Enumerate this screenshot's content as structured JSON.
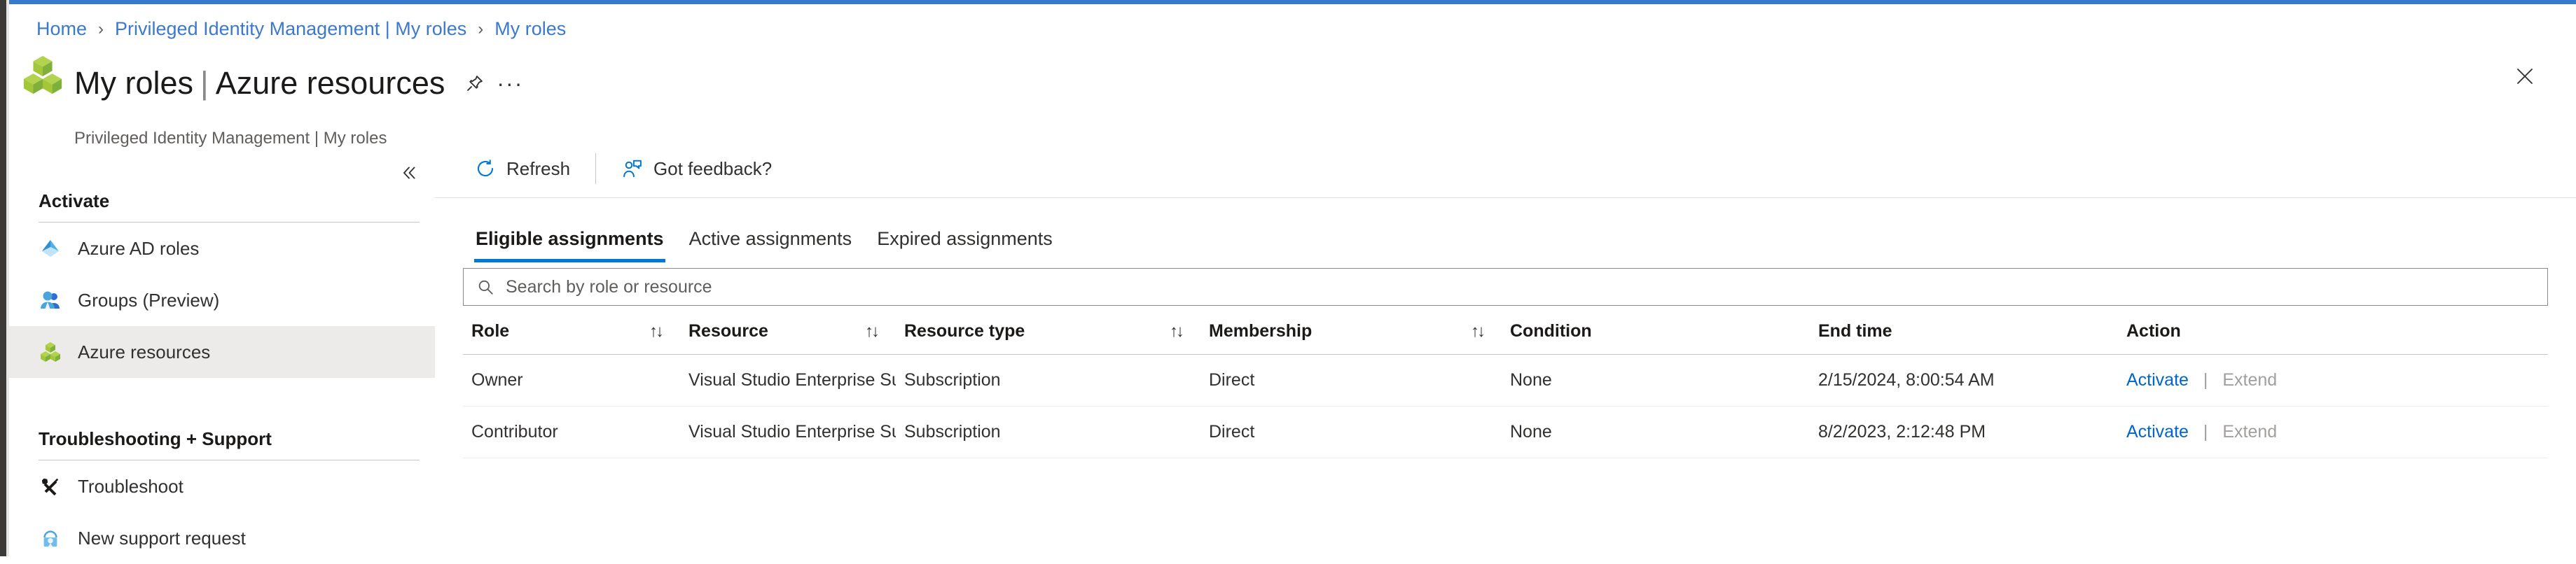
{
  "accent_color": "#3b79cc",
  "link_color": "#0066cc",
  "breadcrumb": {
    "items": [
      {
        "label": "Home"
      },
      {
        "label": "Privileged Identity Management | My roles"
      },
      {
        "label": "My roles"
      }
    ],
    "separator": "›"
  },
  "header": {
    "title_main": "My roles",
    "title_sep": "|",
    "title_secondary": "Azure resources",
    "subtitle": "Privileged Identity Management | My roles",
    "pin_icon": "pin-icon",
    "more_icon": "ellipsis-icon",
    "close_icon": "close-icon",
    "logo_icon": "pim-cubes-icon"
  },
  "sidebar": {
    "collapse_icon": "double-chevron-left-icon",
    "groups": [
      {
        "title": "Activate",
        "items": [
          {
            "label": "Azure AD roles",
            "icon": "azure-ad-icon",
            "selected": false
          },
          {
            "label": "Groups (Preview)",
            "icon": "groups-people-icon",
            "selected": false
          },
          {
            "label": "Azure resources",
            "icon": "azure-resources-cubes-icon",
            "selected": true
          }
        ]
      },
      {
        "title": "Troubleshooting + Support",
        "items": [
          {
            "label": "Troubleshoot",
            "icon": "wrench-screwdriver-icon",
            "selected": false
          },
          {
            "label": "New support request",
            "icon": "headset-support-icon",
            "selected": false
          }
        ]
      }
    ]
  },
  "toolbar": {
    "refresh_label": "Refresh",
    "refresh_icon": "refresh-circular-arrow-icon",
    "feedback_label": "Got feedback?",
    "feedback_icon": "person-speech-bubble-icon"
  },
  "tabs": [
    {
      "label": "Eligible assignments",
      "active": true
    },
    {
      "label": "Active assignments",
      "active": false
    },
    {
      "label": "Expired assignments",
      "active": false
    }
  ],
  "search": {
    "placeholder": "Search by role or resource",
    "value": "",
    "icon": "search-icon"
  },
  "table": {
    "sort_glyph": "↑↓",
    "columns": [
      {
        "label": "Role",
        "sortable": true
      },
      {
        "label": "Resource",
        "sortable": true
      },
      {
        "label": "Resource type",
        "sortable": true
      },
      {
        "label": "Membership",
        "sortable": true
      },
      {
        "label": "Condition",
        "sortable": false
      },
      {
        "label": "End time",
        "sortable": false
      },
      {
        "label": "Action",
        "sortable": false
      }
    ],
    "rows": [
      {
        "role": "Owner",
        "resource": "Visual Studio Enterprise Subscri",
        "resource_type": "Subscription",
        "membership": "Direct",
        "condition": "None",
        "end_time": "2/15/2024, 8:00:54 AM",
        "activate_label": "Activate",
        "action_separator": "|",
        "extend_label": "Extend"
      },
      {
        "role": "Contributor",
        "resource": "Visual Studio Enterprise Subscri",
        "resource_type": "Subscription",
        "membership": "Direct",
        "condition": "None",
        "end_time": "8/2/2023, 2:12:48 PM",
        "activate_label": "Activate",
        "action_separator": "|",
        "extend_label": "Extend"
      }
    ]
  }
}
